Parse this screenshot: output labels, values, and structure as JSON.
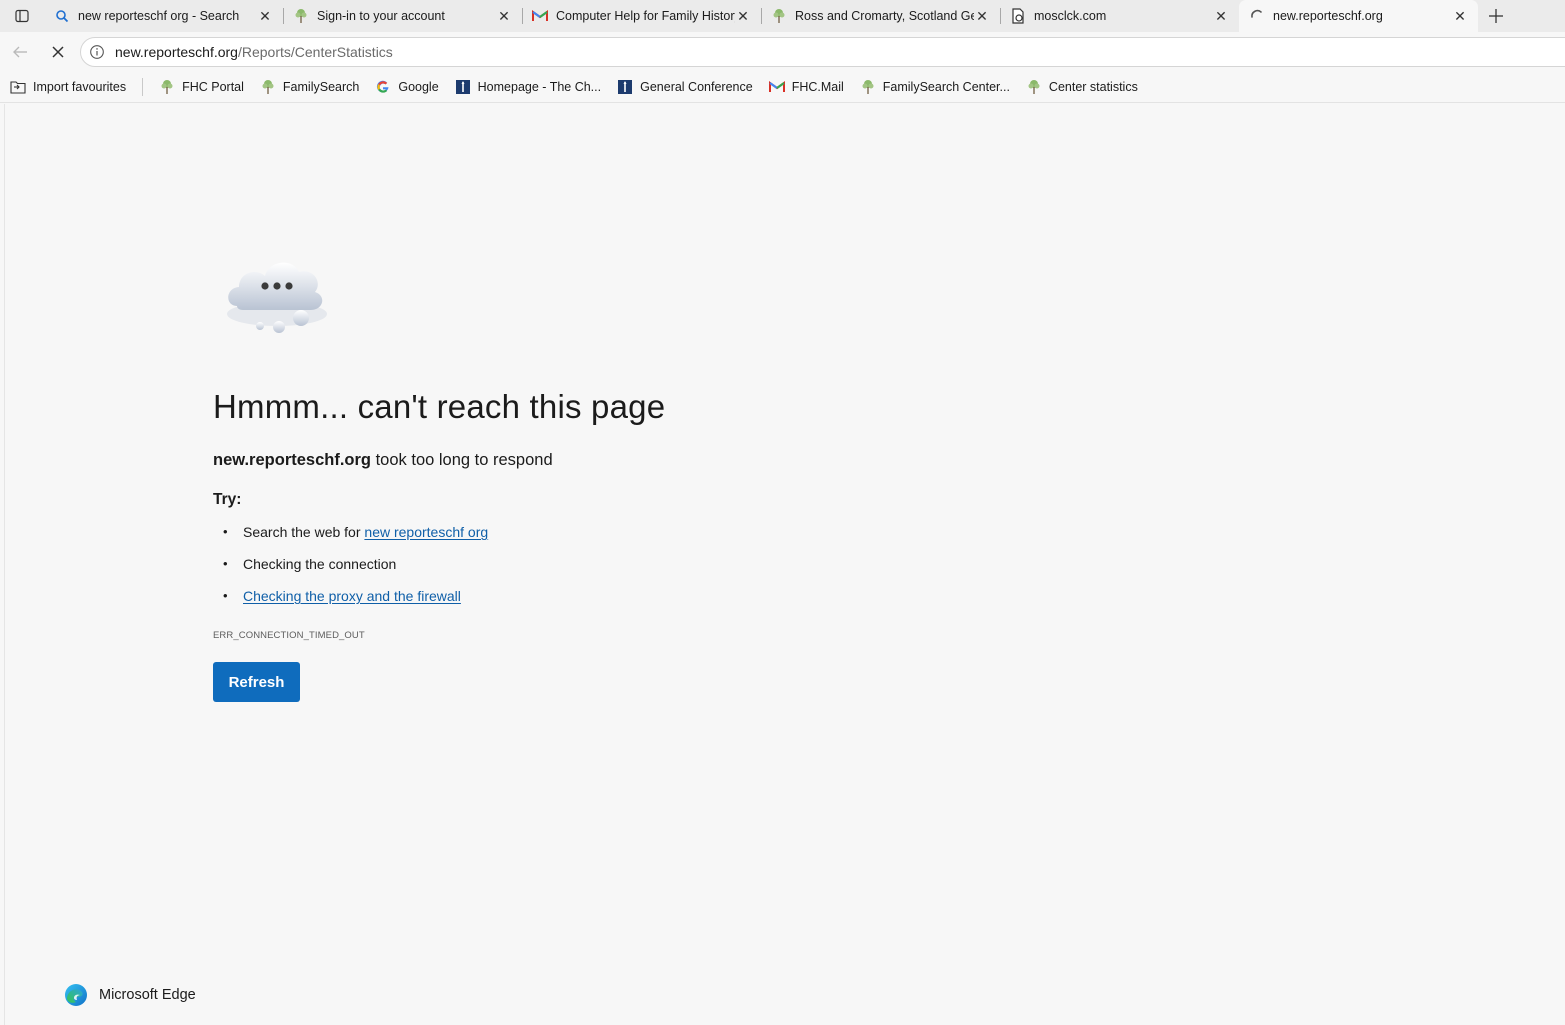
{
  "tabs": [
    {
      "title": "new reporteschf org - Search",
      "icon": "search-icon"
    },
    {
      "title": "Sign-in to your account",
      "icon": "tree-icon"
    },
    {
      "title": "Computer Help for Family History",
      "icon": "gmail-icon"
    },
    {
      "title": "Ross and Cromarty, Scotland Genealogy",
      "icon": "tree-icon"
    },
    {
      "title": "mosclck.com",
      "icon": "page-icon"
    },
    {
      "title": "new.reporteschf.org",
      "icon": "loading-icon",
      "active": true
    }
  ],
  "address_bar": {
    "host": "new.reporteschf.org",
    "path": "/Reports/CenterStatistics"
  },
  "bookmarks": {
    "import": "Import favourites",
    "items": [
      {
        "label": "FHC Portal",
        "icon": "tree-icon"
      },
      {
        "label": "FamilySearch",
        "icon": "tree-icon"
      },
      {
        "label": "Google",
        "icon": "google-icon"
      },
      {
        "label": "Homepage - The Ch...",
        "icon": "church-icon"
      },
      {
        "label": "General Conference",
        "icon": "church-icon"
      },
      {
        "label": "FHC.Mail",
        "icon": "gmail-icon"
      },
      {
        "label": "FamilySearch Center...",
        "icon": "tree-icon"
      },
      {
        "label": "Center statistics",
        "icon": "tree-icon"
      }
    ]
  },
  "error_page": {
    "heading": "Hmmm... can't reach this page",
    "host": "new.reporteschf.org",
    "subtitle_rest": " took too long to respond",
    "try_label": "Try:",
    "suggestion_search_prefix": "Search the web for ",
    "suggestion_search_link": "new reporteschf org",
    "suggestion_connection": "Checking the connection",
    "suggestion_proxy": "Checking the proxy and the firewall",
    "error_code": "ERR_CONNECTION_TIMED_OUT",
    "refresh_label": "Refresh",
    "brand": "Microsoft Edge"
  },
  "colors": {
    "accent": "#0f6cbd",
    "link": "#0f5fa8"
  }
}
